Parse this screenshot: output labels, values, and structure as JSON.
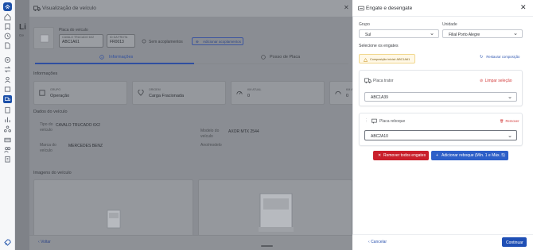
{
  "background": {
    "title": "Visualização de veículo",
    "stub_title": "Li",
    "stub_sub": "Ge",
    "plate_label": "Placa do veículo",
    "vehicle_field_label": "CAVALO TRUCADO 6X2",
    "vehicle_field_value": "ABC1A61",
    "fleet_field_label": "ID DA FROTA",
    "fleet_field_value": "FR0013",
    "no_coupling_text": "Sem acoplamentos",
    "add_coupling_button": "Adicionar acoplamentos",
    "tabs": [
      {
        "label": "Informações",
        "active": true
      },
      {
        "label": "Posso de Placa",
        "active": false
      }
    ],
    "info_section": "Informações",
    "info_cards": [
      {
        "label": "GRUPO",
        "value": "Operação"
      },
      {
        "label": "ORIGEM",
        "value": "Carga Fracionada"
      },
      {
        "label": "KM ATUAL",
        "value": "0"
      },
      {
        "label": "KM ATUAL",
        "value": "0"
      }
    ],
    "data_section": "Dados do veículo",
    "type_label": "Tipo do veículo",
    "type_value": "CAVALO TRUCADO 6X2",
    "brand_label": "Marca do veículo",
    "brand_value": "MERCEDES BENZ",
    "model_label": "Modelo do veículo",
    "model_value": "AXOR MTX 2544",
    "year_label": "Ano/modelo",
    "image_section": "Imagens do veículo",
    "back_label": "Voltar"
  },
  "panel": {
    "title": "Engate e desengate",
    "close_icon": "close-icon",
    "group_label": "Grupo",
    "group_value": "Sul",
    "unit_label": "Unidade",
    "unit_value": "Filial Porto Alegre",
    "select_couplings_label": "Selecione os engates",
    "initial_composition": "Composição inicial: ABC1A61",
    "restore_label": "Restaurar composição",
    "tractor_card_title": "Placa trator",
    "clear_selection_label": "Limpar seleção",
    "tractor_value": "ABC1A39",
    "trailer_card_title": "Placa reboque",
    "remove_label": "Remover",
    "trailer_value": "ABC2A10",
    "remove_all_button": "Remover todos engates",
    "add_trailer_button": "Adicionar reboque (Mín. 1 e Máx. 5)",
    "cancel_label": "Cancelar",
    "continue_label": "Continuar"
  },
  "colors": {
    "primary": "#1f4fb5",
    "danger": "#c91f2b",
    "warning_bg": "#fff8e6"
  }
}
